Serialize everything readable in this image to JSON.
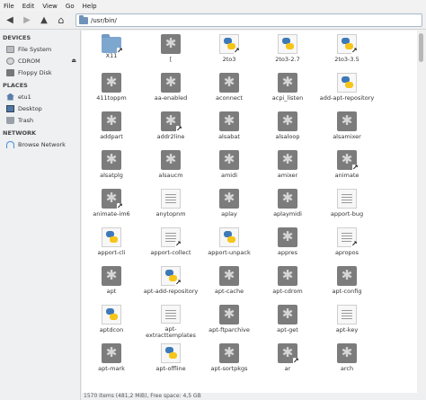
{
  "menu": [
    "File",
    "Edit",
    "View",
    "Go",
    "Help"
  ],
  "location": {
    "path": "/usr/bin/"
  },
  "sidebar": {
    "devices_header": "DEVICES",
    "devices": [
      {
        "label": "File System",
        "icon": "drive-icon"
      },
      {
        "label": "CDROM",
        "icon": "cdrom-icon"
      },
      {
        "label": "Floppy Disk",
        "icon": "floppy-icon"
      }
    ],
    "places_header": "PLACES",
    "places": [
      {
        "label": "etu1",
        "icon": "home-icon"
      },
      {
        "label": "Desktop",
        "icon": "desktop-icon"
      },
      {
        "label": "Trash",
        "icon": "trash-icon"
      }
    ],
    "network_header": "NETWORK",
    "network": [
      {
        "label": "Browse Network",
        "icon": "network-icon"
      }
    ]
  },
  "files": [
    {
      "name": "X11",
      "type": "folder",
      "link": true
    },
    {
      "name": "[",
      "type": "gear",
      "link": false
    },
    {
      "name": "2to3",
      "type": "py",
      "link": true
    },
    {
      "name": "2to3-2.7",
      "type": "py",
      "link": false
    },
    {
      "name": "2to3-3.5",
      "type": "py",
      "link": true
    },
    {
      "name": "411toppm",
      "type": "gear",
      "link": false
    },
    {
      "name": "aa-enabled",
      "type": "gear",
      "link": false
    },
    {
      "name": "aconnect",
      "type": "gear",
      "link": false
    },
    {
      "name": "acpi_listen",
      "type": "gear",
      "link": false
    },
    {
      "name": "add-apt-repository",
      "type": "py",
      "link": false
    },
    {
      "name": "addpart",
      "type": "gear",
      "link": false
    },
    {
      "name": "addr2line",
      "type": "gear",
      "link": true
    },
    {
      "name": "alsabat",
      "type": "gear",
      "link": false
    },
    {
      "name": "alsaloop",
      "type": "gear",
      "link": false
    },
    {
      "name": "alsamixer",
      "type": "gear",
      "link": false
    },
    {
      "name": "alsatplg",
      "type": "gear",
      "link": false
    },
    {
      "name": "alsaucm",
      "type": "gear",
      "link": false
    },
    {
      "name": "amidi",
      "type": "gear",
      "link": false
    },
    {
      "name": "amixer",
      "type": "gear",
      "link": false
    },
    {
      "name": "animate",
      "type": "gear",
      "link": true
    },
    {
      "name": "animate-im6",
      "type": "gear",
      "link": true
    },
    {
      "name": "anytopnm",
      "type": "doc",
      "link": false
    },
    {
      "name": "aplay",
      "type": "gear",
      "link": false
    },
    {
      "name": "aplaymidi",
      "type": "gear",
      "link": false
    },
    {
      "name": "apport-bug",
      "type": "doc",
      "link": false
    },
    {
      "name": "apport-cli",
      "type": "py",
      "link": false
    },
    {
      "name": "apport-collect",
      "type": "doc",
      "link": true
    },
    {
      "name": "apport-unpack",
      "type": "py",
      "link": false
    },
    {
      "name": "appres",
      "type": "gear",
      "link": false
    },
    {
      "name": "apropos",
      "type": "doc",
      "link": true
    },
    {
      "name": "apt",
      "type": "gear",
      "link": false
    },
    {
      "name": "apt-add-repository",
      "type": "py",
      "link": true
    },
    {
      "name": "apt-cache",
      "type": "gear",
      "link": false
    },
    {
      "name": "apt-cdrom",
      "type": "gear",
      "link": false
    },
    {
      "name": "apt-config",
      "type": "gear",
      "link": false
    },
    {
      "name": "aptdcon",
      "type": "py",
      "link": false
    },
    {
      "name": "apt-\nextracttemplates",
      "type": "doc",
      "link": false
    },
    {
      "name": "apt-ftparchive",
      "type": "gear",
      "link": false
    },
    {
      "name": "apt-get",
      "type": "gear",
      "link": false
    },
    {
      "name": "apt-key",
      "type": "doc",
      "link": false
    },
    {
      "name": "apt-mark",
      "type": "gear",
      "link": false
    },
    {
      "name": "apt-offline",
      "type": "py",
      "link": false
    },
    {
      "name": "apt-sortpkgs",
      "type": "gear",
      "link": false
    },
    {
      "name": "ar",
      "type": "gear",
      "link": true
    },
    {
      "name": "arch",
      "type": "gear",
      "link": false
    }
  ],
  "status": "1570 items (481,2 MiB), Free space: 4,5 GB"
}
